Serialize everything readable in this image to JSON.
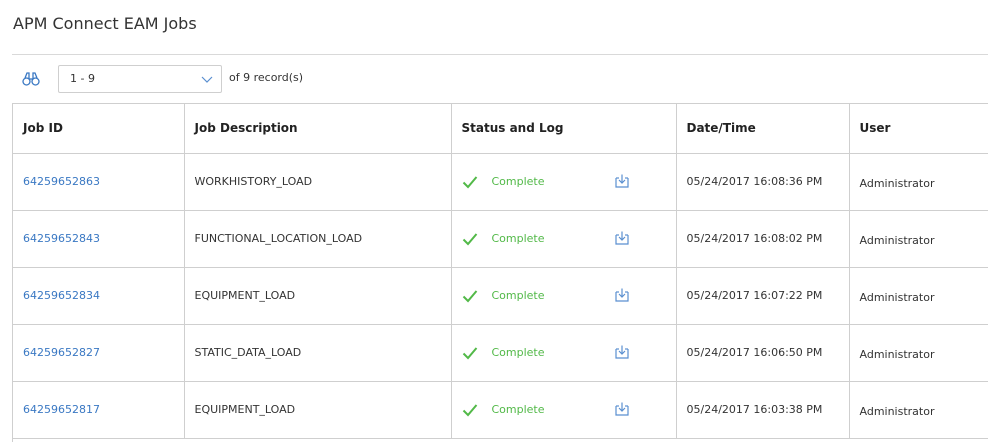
{
  "page": {
    "title": "APM Connect EAM Jobs"
  },
  "toolbar": {
    "find_icon": "binoculars-icon",
    "pager_value": "1 - 9",
    "record_count": "of 9 record(s)"
  },
  "grid": {
    "columns": [
      {
        "key": "job_id",
        "label": "Job ID"
      },
      {
        "key": "description",
        "label": "Job Description"
      },
      {
        "key": "status",
        "label": "Status and Log"
      },
      {
        "key": "datetime",
        "label": "Date/Time"
      },
      {
        "key": "user",
        "label": "User"
      }
    ],
    "rows": [
      {
        "job_id": "64259652863",
        "description": "WORKHISTORY_LOAD",
        "status": "Complete",
        "datetime": "05/24/2017 16:08:36 PM",
        "user": "Administrator"
      },
      {
        "job_id": "64259652843",
        "description": "FUNCTIONAL_LOCATION_LOAD",
        "status": "Complete",
        "datetime": "05/24/2017 16:08:02 PM",
        "user": "Administrator"
      },
      {
        "job_id": "64259652834",
        "description": "EQUIPMENT_LOAD",
        "status": "Complete",
        "datetime": "05/24/2017 16:07:22 PM",
        "user": "Administrator"
      },
      {
        "job_id": "64259652827",
        "description": "STATIC_DATA_LOAD",
        "status": "Complete",
        "datetime": "05/24/2017 16:06:50 PM",
        "user": "Administrator"
      },
      {
        "job_id": "64259652817",
        "description": "EQUIPMENT_LOAD",
        "status": "Complete",
        "datetime": "05/24/2017 16:03:38 PM",
        "user": "Administrator"
      }
    ]
  },
  "colors": {
    "link": "#3a78c3",
    "status_complete": "#52b948",
    "grid_border": "#cfcfcf"
  }
}
